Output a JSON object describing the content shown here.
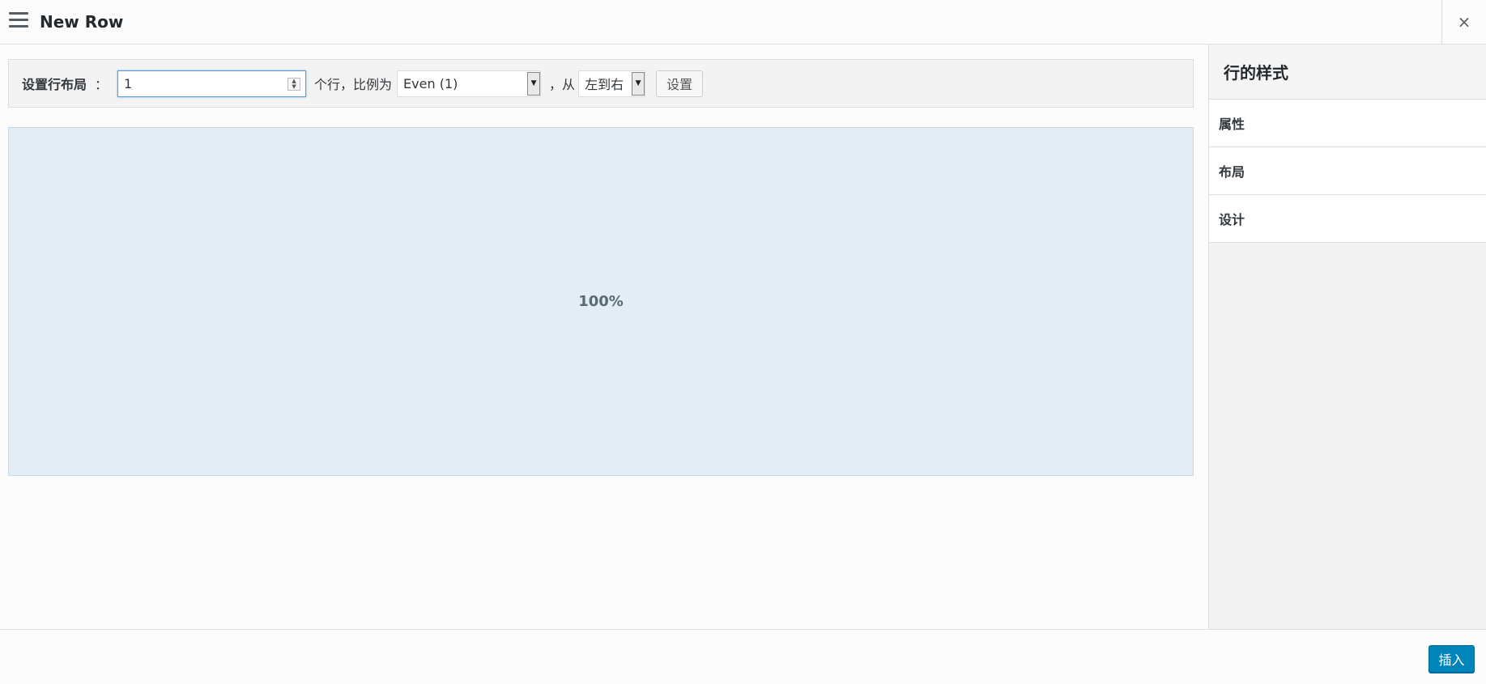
{
  "header": {
    "title": "New Row",
    "close_glyph": "×"
  },
  "toolbar": {
    "layout_label": "设置行布局",
    "colon": "：",
    "columns_value": "1",
    "rows_text": "个行，比例为",
    "ratio_selected": "Even (1)",
    "from_text": "，从",
    "direction_selected": "左到右",
    "set_button": "设置"
  },
  "preview": {
    "column_label": "100%"
  },
  "sidebar": {
    "title": "行的样式",
    "items": [
      {
        "label": "属性"
      },
      {
        "label": "布局"
      },
      {
        "label": "设计"
      }
    ]
  },
  "footer": {
    "insert_button": "插入"
  },
  "colors": {
    "accent": "#0085ba",
    "preview_bg": "#e2eef4",
    "sidebar_bg": "#f2f2f2"
  },
  "icons": [
    "menu-icon",
    "close-icon",
    "spinner-icon",
    "dropdown-arrow-icon"
  ]
}
